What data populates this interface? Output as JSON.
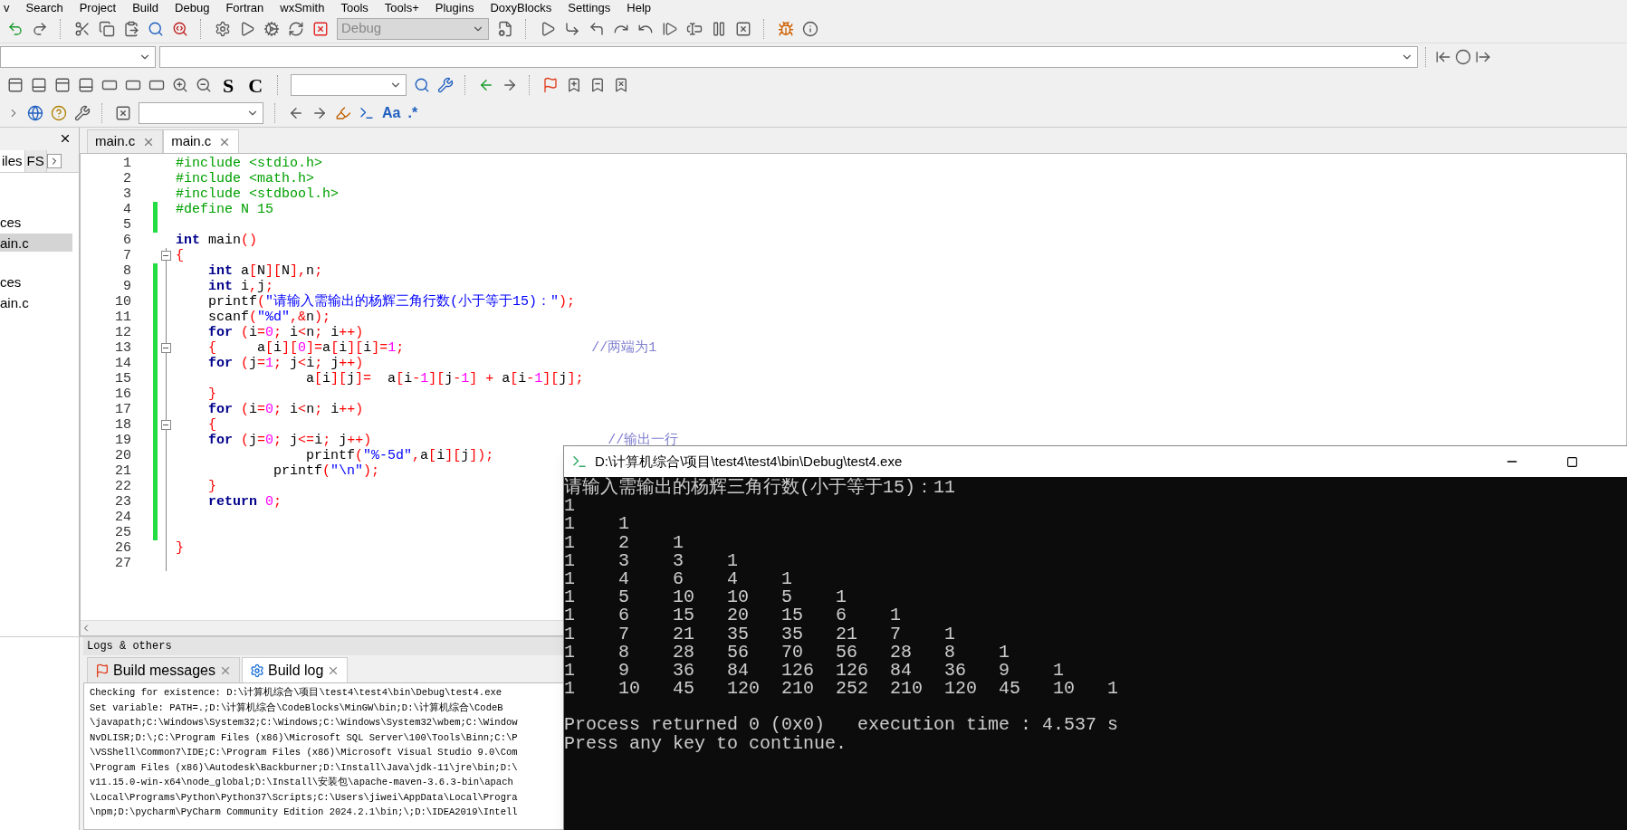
{
  "menu": [
    "v",
    "Search",
    "Project",
    "Build",
    "Debug",
    "Fortran",
    "wxSmith",
    "Tools",
    "Tools+",
    "Plugins",
    "DoxyBlocks",
    "Settings",
    "Help"
  ],
  "toolbar": {
    "build_target": {
      "value": "Debug",
      "disabled": true
    },
    "s_label": "S",
    "c_label": "C",
    "match_case_label": "Aa",
    "regex_label": ".*"
  },
  "left_panel": {
    "tabs": [
      {
        "label": "iles",
        "selected": true
      },
      {
        "label": "FS",
        "selected": false
      }
    ],
    "items": [
      {
        "label": "ces",
        "selected": false
      },
      {
        "label": "ain.c",
        "selected": true
      },
      {
        "label": "ces",
        "selected": false
      },
      {
        "label": "ain.c",
        "selected": false
      }
    ]
  },
  "editor": {
    "tabs": [
      {
        "label": "main.c",
        "selected": false
      },
      {
        "label": "main.c",
        "selected": true
      }
    ],
    "lines": [
      {
        "n": "1",
        "modified": false,
        "fold": false,
        "tokens": [
          {
            "kind": "pp",
            "text": "#include <stdio.h>"
          }
        ]
      },
      {
        "n": "2",
        "modified": false,
        "fold": false,
        "tokens": [
          {
            "kind": "pp",
            "text": "#include <math.h>"
          }
        ]
      },
      {
        "n": "3",
        "modified": false,
        "fold": false,
        "tokens": [
          {
            "kind": "pp",
            "text": "#include <stdbool.h>"
          }
        ]
      },
      {
        "n": "4",
        "modified": true,
        "fold": false,
        "tokens": [
          {
            "kind": "pp",
            "text": "#define N 15"
          }
        ]
      },
      {
        "n": "5",
        "modified": true,
        "fold": false
      },
      {
        "n": "6",
        "modified": false,
        "fold": false,
        "tokens": [
          {
            "kind": "kw",
            "text": "int"
          },
          {
            "kind": "tx",
            "text": " main"
          },
          {
            "kind": "op",
            "text": "()"
          }
        ]
      },
      {
        "n": "7",
        "modified": false,
        "fold": true,
        "tokens": [
          {
            "kind": "op",
            "text": "{"
          }
        ]
      },
      {
        "n": "8",
        "modified": true,
        "fold": false,
        "tokens": [
          {
            "kind": "kw",
            "text": "    int"
          },
          {
            "kind": "tx",
            "text": " a"
          },
          {
            "kind": "op",
            "text": "["
          },
          {
            "kind": "tx",
            "text": "N"
          },
          {
            "kind": "op",
            "text": "]["
          },
          {
            "kind": "tx",
            "text": "N"
          },
          {
            "kind": "op",
            "text": "],"
          },
          {
            "kind": "tx",
            "text": "n"
          },
          {
            "kind": "op",
            "text": ";"
          }
        ]
      },
      {
        "n": "9",
        "modified": true,
        "fold": false,
        "tokens": [
          {
            "kind": "kw",
            "text": "    int"
          },
          {
            "kind": "tx",
            "text": " i"
          },
          {
            "kind": "op",
            "text": ","
          },
          {
            "kind": "tx",
            "text": "j"
          },
          {
            "kind": "op",
            "text": ";"
          }
        ]
      },
      {
        "n": "10",
        "modified": true,
        "fold": false,
        "tokens": [
          {
            "kind": "tx",
            "text": "    printf"
          },
          {
            "kind": "op",
            "text": "("
          },
          {
            "kind": "str",
            "text": "\"请输入需输出的杨辉三角行数(小于等于15)：\""
          },
          {
            "kind": "op",
            "text": ");"
          }
        ]
      },
      {
        "n": "11",
        "modified": true,
        "fold": false,
        "tokens": [
          {
            "kind": "tx",
            "text": "    scanf"
          },
          {
            "kind": "op",
            "text": "("
          },
          {
            "kind": "str",
            "text": "\"%d\""
          },
          {
            "kind": "op",
            "text": ",&"
          },
          {
            "kind": "tx",
            "text": "n"
          },
          {
            "kind": "op",
            "text": ");"
          }
        ]
      },
      {
        "n": "12",
        "modified": true,
        "fold": false,
        "tokens": [
          {
            "kind": "kw",
            "text": "    for"
          },
          {
            "kind": "op",
            "text": " ("
          },
          {
            "kind": "tx",
            "text": "i"
          },
          {
            "kind": "op",
            "text": "="
          },
          {
            "kind": "num",
            "text": "0"
          },
          {
            "kind": "op",
            "text": ";"
          },
          {
            "kind": "tx",
            "text": " i"
          },
          {
            "kind": "op",
            "text": "<"
          },
          {
            "kind": "tx",
            "text": "n"
          },
          {
            "kind": "op",
            "text": ";"
          },
          {
            "kind": "tx",
            "text": " i"
          },
          {
            "kind": "op",
            "text": "++)"
          }
        ]
      },
      {
        "n": "13",
        "modified": true,
        "fold": true,
        "tokens": [
          {
            "kind": "op",
            "text": "    {"
          },
          {
            "kind": "tx",
            "text": "     a"
          },
          {
            "kind": "op",
            "text": "["
          },
          {
            "kind": "tx",
            "text": "i"
          },
          {
            "kind": "op",
            "text": "]["
          },
          {
            "kind": "num",
            "text": "0"
          },
          {
            "kind": "op",
            "text": "]="
          },
          {
            "kind": "tx",
            "text": "a"
          },
          {
            "kind": "op",
            "text": "["
          },
          {
            "kind": "tx",
            "text": "i"
          },
          {
            "kind": "op",
            "text": "]["
          },
          {
            "kind": "tx",
            "text": "i"
          },
          {
            "kind": "op",
            "text": "]="
          },
          {
            "kind": "num",
            "text": "1"
          },
          {
            "kind": "op",
            "text": ";"
          },
          {
            "kind": "cm",
            "text": "                       //两端为1"
          }
        ]
      },
      {
        "n": "14",
        "modified": true,
        "fold": false,
        "tokens": [
          {
            "kind": "kw",
            "text": "    for"
          },
          {
            "kind": "op",
            "text": " ("
          },
          {
            "kind": "tx",
            "text": "j"
          },
          {
            "kind": "op",
            "text": "="
          },
          {
            "kind": "num",
            "text": "1"
          },
          {
            "kind": "op",
            "text": ";"
          },
          {
            "kind": "tx",
            "text": " j"
          },
          {
            "kind": "op",
            "text": "<"
          },
          {
            "kind": "tx",
            "text": "i"
          },
          {
            "kind": "op",
            "text": ";"
          },
          {
            "kind": "tx",
            "text": " j"
          },
          {
            "kind": "op",
            "text": "++)"
          }
        ]
      },
      {
        "n": "15",
        "modified": true,
        "fold": false,
        "tokens": [
          {
            "kind": "tx",
            "text": "                a"
          },
          {
            "kind": "op",
            "text": "["
          },
          {
            "kind": "tx",
            "text": "i"
          },
          {
            "kind": "op",
            "text": "]["
          },
          {
            "kind": "tx",
            "text": "j"
          },
          {
            "kind": "op",
            "text": "]="
          },
          {
            "kind": "tx",
            "text": "  a"
          },
          {
            "kind": "op",
            "text": "["
          },
          {
            "kind": "tx",
            "text": "i"
          },
          {
            "kind": "op",
            "text": "-"
          },
          {
            "kind": "num",
            "text": "1"
          },
          {
            "kind": "op",
            "text": "]["
          },
          {
            "kind": "tx",
            "text": "j"
          },
          {
            "kind": "op",
            "text": "-"
          },
          {
            "kind": "num",
            "text": "1"
          },
          {
            "kind": "op",
            "text": "] +"
          },
          {
            "kind": "tx",
            "text": " a"
          },
          {
            "kind": "op",
            "text": "["
          },
          {
            "kind": "tx",
            "text": "i"
          },
          {
            "kind": "op",
            "text": "-"
          },
          {
            "kind": "num",
            "text": "1"
          },
          {
            "kind": "op",
            "text": "]["
          },
          {
            "kind": "tx",
            "text": "j"
          },
          {
            "kind": "op",
            "text": "];"
          }
        ]
      },
      {
        "n": "16",
        "modified": true,
        "fold": false,
        "tokens": [
          {
            "kind": "op",
            "text": "    }"
          }
        ]
      },
      {
        "n": "17",
        "modified": true,
        "fold": false,
        "tokens": [
          {
            "kind": "kw",
            "text": "    for"
          },
          {
            "kind": "op",
            "text": " ("
          },
          {
            "kind": "tx",
            "text": "i"
          },
          {
            "kind": "op",
            "text": "="
          },
          {
            "kind": "num",
            "text": "0"
          },
          {
            "kind": "op",
            "text": ";"
          },
          {
            "kind": "tx",
            "text": " i"
          },
          {
            "kind": "op",
            "text": "<"
          },
          {
            "kind": "tx",
            "text": "n"
          },
          {
            "kind": "op",
            "text": ";"
          },
          {
            "kind": "tx",
            "text": " i"
          },
          {
            "kind": "op",
            "text": "++)"
          }
        ]
      },
      {
        "n": "18",
        "modified": true,
        "fold": true,
        "tokens": [
          {
            "kind": "op",
            "text": "    {"
          }
        ]
      },
      {
        "n": "19",
        "modified": true,
        "fold": false,
        "tokens": [
          {
            "kind": "kw",
            "text": "    for"
          },
          {
            "kind": "op",
            "text": " ("
          },
          {
            "kind": "tx",
            "text": "j"
          },
          {
            "kind": "op",
            "text": "="
          },
          {
            "kind": "num",
            "text": "0"
          },
          {
            "kind": "op",
            "text": ";"
          },
          {
            "kind": "tx",
            "text": " j"
          },
          {
            "kind": "op",
            "text": "<="
          },
          {
            "kind": "tx",
            "text": "i"
          },
          {
            "kind": "op",
            "text": ";"
          },
          {
            "kind": "tx",
            "text": " j"
          },
          {
            "kind": "op",
            "text": "++)"
          },
          {
            "kind": "cm",
            "text": "                             //输出一行"
          }
        ]
      },
      {
        "n": "20",
        "modified": true,
        "fold": false,
        "tokens": [
          {
            "kind": "tx",
            "text": "                printf"
          },
          {
            "kind": "op",
            "text": "("
          },
          {
            "kind": "str",
            "text": "\"%-5d\""
          },
          {
            "kind": "op",
            "text": ","
          },
          {
            "kind": "tx",
            "text": "a"
          },
          {
            "kind": "op",
            "text": "["
          },
          {
            "kind": "tx",
            "text": "i"
          },
          {
            "kind": "op",
            "text": "]["
          },
          {
            "kind": "tx",
            "text": "j"
          },
          {
            "kind": "op",
            "text": "]);"
          }
        ]
      },
      {
        "n": "21",
        "modified": true,
        "fold": false,
        "tokens": [
          {
            "kind": "tx",
            "text": "            printf"
          },
          {
            "kind": "op",
            "text": "("
          },
          {
            "kind": "str",
            "text": "\"\\n\""
          },
          {
            "kind": "op",
            "text": ");"
          }
        ]
      },
      {
        "n": "22",
        "modified": true,
        "fold": false,
        "tokens": [
          {
            "kind": "op",
            "text": "    }"
          }
        ]
      },
      {
        "n": "23",
        "modified": true,
        "fold": false,
        "tokens": [
          {
            "kind": "kw",
            "text": "    return"
          },
          {
            "kind": "num",
            "text": " 0"
          },
          {
            "kind": "op",
            "text": ";"
          }
        ]
      },
      {
        "n": "24",
        "modified": true,
        "fold": false
      },
      {
        "n": "25",
        "modified": true,
        "fold": false
      },
      {
        "n": "26",
        "modified": false,
        "fold": false,
        "tokens": [
          {
            "kind": "op",
            "text": "}"
          }
        ]
      },
      {
        "n": "27",
        "modified": false,
        "fold": false
      }
    ]
  },
  "logs": {
    "title": "Logs & others",
    "tabs": [
      {
        "label": "Build messages",
        "selected": false
      },
      {
        "label": "Build log",
        "selected": true
      }
    ],
    "lines": [
      "Checking for existence: D:\\计算机综合\\项目\\test4\\test4\\bin\\Debug\\test4.exe",
      "Set variable: PATH=.;D:\\计算机综合\\CodeBlocks\\MinGW\\bin;D:\\计算机综合\\CodeB",
      "\\javapath;C:\\Windows\\System32;C:\\Windows;C:\\Windows\\System32\\wbem;C:\\Window",
      "NvDLISR;D:\\;C:\\Program Files (x86)\\Microsoft SQL Server\\100\\Tools\\Binn;C:\\P",
      "\\VSShell\\Common7\\IDE;C:\\Program Files (x86)\\Microsoft Visual Studio 9.0\\Com",
      "\\Program Files (x86)\\Autodesk\\Backburner;D:\\Install\\Java\\jdk-11\\jre\\bin;D:\\",
      "v11.15.0-win-x64\\node_global;D:\\Install\\安装包\\apache-maven-3.6.3-bin\\apach",
      "\\Local\\Programs\\Python\\Python37\\Scripts;C:\\Users\\jiwei\\AppData\\Local\\Progra",
      "\\npm;D:\\pycharm\\PyCharm Community Edition 2024.2.1\\bin;\\;D:\\IDEA2019\\Intell"
    ]
  },
  "console": {
    "title": "D:\\计算机综合\\项目\\test4\\test4\\bin\\Debug\\test4.exe",
    "prompt_line": "请输入需输出的杨辉三角行数(小于等于15)：11",
    "output_rows": [
      "1",
      "1    1",
      "1    2    1",
      "1    3    3    1",
      "1    4    6    4    1",
      "1    5    10   10   5    1",
      "1    6    15   20   15   6    1",
      "1    7    21   35   35   21   7    1",
      "1    8    28   56   70   56   28   8    1",
      "1    9    36   84   126  126  84   36   9    1",
      "1    10   45   120  210  252  210  120  45   10   1"
    ],
    "status_lines": [
      "Process returned 0 (0x0)   execution time : 4.537 s",
      "Press any key to continue."
    ]
  }
}
